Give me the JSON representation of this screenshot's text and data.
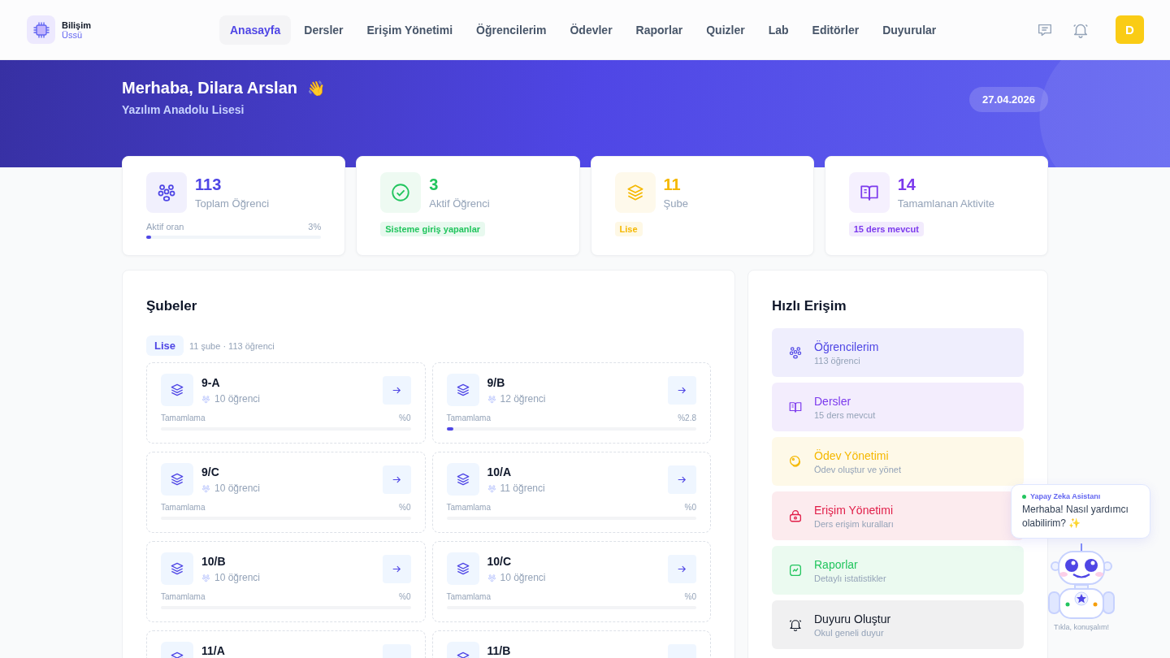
{
  "header": {
    "logo": {
      "title": "Bilişim",
      "subtitle": "Üssü"
    },
    "nav": [
      {
        "label": "Anasayfa",
        "selected": true
      },
      {
        "label": "Dersler",
        "selected": false
      },
      {
        "label": "Erişim Yönetimi",
        "selected": false
      },
      {
        "label": "Öğrencilerim",
        "selected": false
      },
      {
        "label": "Ödevler",
        "selected": false
      },
      {
        "label": "Raporlar",
        "selected": false
      },
      {
        "label": "Quizler",
        "selected": false
      },
      {
        "label": "Lab",
        "selected": false
      },
      {
        "label": "Editörler",
        "selected": false
      },
      {
        "label": "Duyurular",
        "selected": false
      }
    ],
    "avatar": "D"
  },
  "hero": {
    "greeting": "Merhaba, Dilara Arslan",
    "wave": "👋",
    "school": "Yazılım Anadolu Lisesi",
    "date": "27.04.2026"
  },
  "stats": [
    {
      "kind": "progress",
      "color": "#4f46e5",
      "value": "113",
      "label": "Toplam Öğrenci",
      "footer_label": "Aktif oran",
      "footer_value": "3%",
      "level": 0.03
    },
    {
      "kind": "badge",
      "color": "#22c55e",
      "value": "3",
      "label": "Aktif Öğrenci",
      "badge": "Sisteme giriş yapanlar"
    },
    {
      "kind": "badge",
      "color": "#f5b800",
      "value": "11",
      "label": "Şube",
      "badge": "Lise"
    },
    {
      "kind": "badge",
      "color": "#7c3aed",
      "value": "14",
      "label": "Tamamlanan Aktivite",
      "badge": "15 ders mevcut"
    }
  ],
  "branches": {
    "title": "Şubeler",
    "level_tag": "Lise",
    "summary": "11 şube · 113 öğrenci",
    "items": [
      {
        "name": "9-A",
        "students": "10 öğrenci",
        "progress_label": "Tamamlama",
        "progress_value": "%0",
        "level": 0
      },
      {
        "name": "9/B",
        "students": "12 öğrenci",
        "progress_label": "Tamamlama",
        "progress_value": "%2.8",
        "level": 0.028
      },
      {
        "name": "9/C",
        "students": "10 öğrenci",
        "progress_label": "Tamamlama",
        "progress_value": "%0",
        "level": 0
      },
      {
        "name": "10/A",
        "students": "11 öğrenci",
        "progress_label": "Tamamlama",
        "progress_value": "%0",
        "level": 0
      },
      {
        "name": "10/B",
        "students": "10 öğrenci",
        "progress_label": "Tamamlama",
        "progress_value": "%0",
        "level": 0
      },
      {
        "name": "10/C",
        "students": "10 öğrenci",
        "progress_label": "Tamamlama",
        "progress_value": "%0",
        "level": 0
      },
      {
        "name": "11/A"
      },
      {
        "name": "11/B"
      }
    ]
  },
  "quick_access": {
    "title": "Hızlı Erişim",
    "items": [
      {
        "color": "#4f46e5",
        "title": "Öğrencilerim",
        "subtitle": "113 öğrenci"
      },
      {
        "color": "#7c3aed",
        "title": "Dersler",
        "subtitle": "15 ders mevcut"
      },
      {
        "color": "#f5b800",
        "title": "Ödev Yönetimi",
        "subtitle": "Ödev oluştur ve yönet"
      },
      {
        "color": "#e11d48",
        "title": "Erişim Yönetimi",
        "subtitle": "Ders erişim kuralları"
      },
      {
        "color": "#22c55e",
        "title": "Raporlar",
        "subtitle": "Detaylı istatistikler"
      },
      {
        "color": "#111827",
        "title": "Duyuru Oluştur",
        "subtitle": "Okul geneli duyur"
      }
    ]
  },
  "assistant": {
    "name": "Yapay Zeka Asistanı",
    "online": true,
    "message": "Merhaba! Nasıl yardımcı olabilirim?",
    "sparkle": "✨",
    "caption": "Tıkla, konuşalım!"
  }
}
